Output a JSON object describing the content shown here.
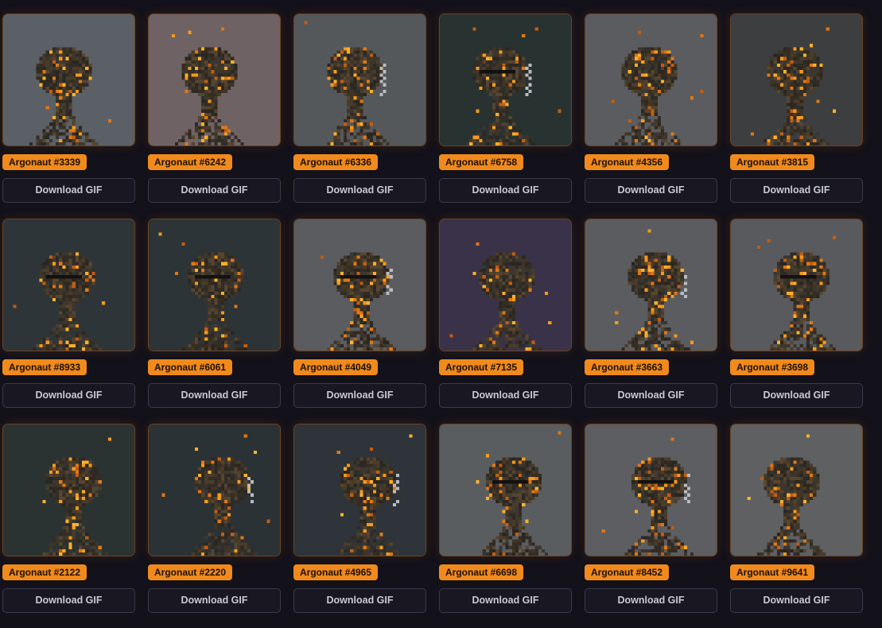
{
  "download_label": "Download GIF",
  "cards": [
    {
      "name": "Argonaut #3339",
      "bg": "#5b6066"
    },
    {
      "name": "Argonaut #6242",
      "bg": "#6f6264"
    },
    {
      "name": "Argonaut #6336",
      "bg": "#55585b"
    },
    {
      "name": "Argonaut #6758",
      "bg": "#283231"
    },
    {
      "name": "Argonaut #4356",
      "bg": "#5a5c60"
    },
    {
      "name": "Argonaut #3815",
      "bg": "#3d3e40"
    },
    {
      "name": "Argonaut #8933",
      "bg": "#2e3539"
    },
    {
      "name": "Argonaut #6061",
      "bg": "#2d3437"
    },
    {
      "name": "Argonaut #4049",
      "bg": "#5a5c60"
    },
    {
      "name": "Argonaut #7135",
      "bg": "#3a3248"
    },
    {
      "name": "Argonaut #3663",
      "bg": "#5a5c60"
    },
    {
      "name": "Argonaut #3698",
      "bg": "#585a5d"
    },
    {
      "name": "Argonaut #2122",
      "bg": "#2a3331"
    },
    {
      "name": "Argonaut #2220",
      "bg": "#2b3235"
    },
    {
      "name": "Argonaut #4965",
      "bg": "#2e3439"
    },
    {
      "name": "Argonaut #6698",
      "bg": "#5a5d60"
    },
    {
      "name": "Argonaut #8452",
      "bg": "#5c5e62"
    },
    {
      "name": "Argonaut #9641",
      "bg": "#5e6062"
    }
  ]
}
